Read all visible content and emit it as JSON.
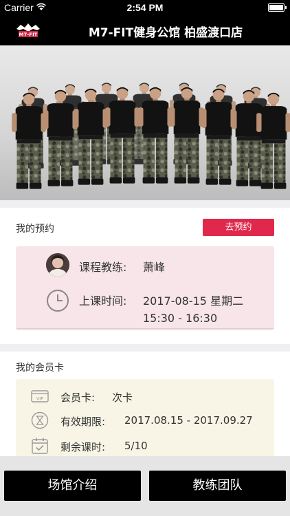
{
  "status_bar": {
    "carrier": "Carrier",
    "time": "2:54 PM"
  },
  "nav": {
    "logo_text": "M7-FIT",
    "title": "M7-FIT健身公馆 柏盛渡口店"
  },
  "appointment": {
    "section_title": "我的预约",
    "book_button": "去预约",
    "coach_label": "课程教练:",
    "coach_name": "萧峰",
    "time_label": "上课时间:",
    "date": "2017-08-15 星期二",
    "time_range": "15:30 - 16:30"
  },
  "membership": {
    "section_title": "我的会员卡",
    "card_label": "会员卡:",
    "card_value": "次卡",
    "card_icon_text": "VIP",
    "validity_label": "有效期限:",
    "validity_value": "2017.08.15 - 2017.09.27",
    "remaining_label": "剩余课时:",
    "remaining_value": "5/10"
  },
  "bottom_buttons": {
    "venue_intro": "场馆介绍",
    "coach_team": "教练团队"
  },
  "colors": {
    "accent": "#e0284d",
    "appointment_card_bg": "#f7e5e9",
    "member_card_bg": "#f8f5e6",
    "bar": "#000000"
  },
  "icons": [
    "wifi-icon",
    "battery-icon",
    "logo-icon",
    "hero-image",
    "avatar",
    "clock-icon",
    "vip-card-icon",
    "hourglass-icon",
    "calendar-check-icon"
  ]
}
